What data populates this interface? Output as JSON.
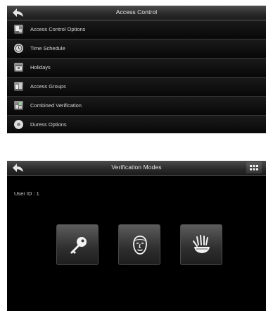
{
  "access_control": {
    "title": "Access Control",
    "back_icon": "back-arrow-icon",
    "items": [
      {
        "label": "Access Control Options",
        "icon": "access-options-icon"
      },
      {
        "label": "Time Schedule",
        "icon": "clock-icon"
      },
      {
        "label": "Holidays",
        "icon": "calendar-icon"
      },
      {
        "label": "Access Groups",
        "icon": "group-icon"
      },
      {
        "label": "Combined Verification",
        "icon": "combined-verification-icon"
      },
      {
        "label": "Duress Options",
        "icon": "duress-icon"
      }
    ]
  },
  "verification_modes": {
    "title": "Verification Modes",
    "user_id": "User ID : 1",
    "modes": [
      {
        "icon": "key-icon"
      },
      {
        "icon": "face-icon"
      },
      {
        "icon": "palm-icon"
      }
    ]
  }
}
